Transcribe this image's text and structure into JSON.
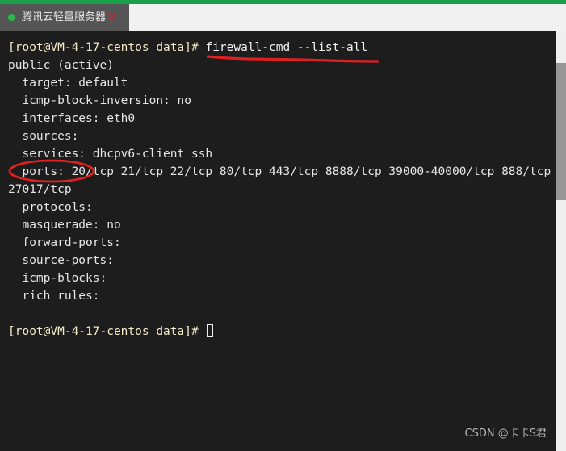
{
  "window": {
    "accent_color": "#18a04a",
    "tabbar_bg": "#f1f1f1",
    "terminal_bg": "#1d1d1d"
  },
  "tabbar": {
    "tab": {
      "status_dot": "connected-dot",
      "label": "腾讯云轻量服务器",
      "close_label": "✕",
      "close_color": "#d42a2a",
      "dot_color": "#2eb84a"
    }
  },
  "terminal": {
    "lines": [
      {
        "type": "prompt_cmd",
        "prompt": "[root@VM-4-17-centos data]# ",
        "command": "firewall-cmd --list-all"
      },
      {
        "type": "out",
        "text": "public (active)"
      },
      {
        "type": "out",
        "text": "  target: default"
      },
      {
        "type": "out",
        "text": "  icmp-block-inversion: no"
      },
      {
        "type": "out",
        "text": "  interfaces: eth0"
      },
      {
        "type": "out",
        "text": "  sources:"
      },
      {
        "type": "out",
        "text": "  services: dhcpv6-client ssh"
      },
      {
        "type": "out",
        "text": "  ports: 20/tcp 21/tcp 22/tcp 80/tcp 443/tcp 8888/tcp 39000-40000/tcp 888/tcp"
      },
      {
        "type": "out",
        "text": "27017/tcp"
      },
      {
        "type": "out",
        "text": "  protocols:"
      },
      {
        "type": "out",
        "text": "  masquerade: no"
      },
      {
        "type": "out",
        "text": "  forward-ports:"
      },
      {
        "type": "out",
        "text": "  source-ports:"
      },
      {
        "type": "out",
        "text": "  icmp-blocks:"
      },
      {
        "type": "out",
        "text": "  rich rules:"
      },
      {
        "type": "blank",
        "text": " "
      },
      {
        "type": "prompt_cursor",
        "prompt": "[root@VM-4-17-centos data]# "
      }
    ]
  },
  "annotations": {
    "color": "#e02020",
    "underline": {
      "target": "firewall-cmd --list-all"
    },
    "ellipse": {
      "target": "27017/tcp"
    }
  },
  "scrollbar": {
    "track_color": "#efefef",
    "thumb_color": "#969696"
  },
  "watermark": {
    "text": "CSDN @卡卡S君"
  }
}
